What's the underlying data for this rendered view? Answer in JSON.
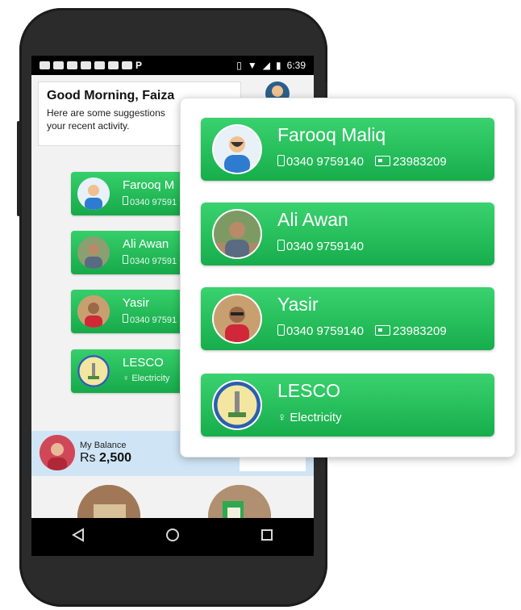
{
  "status_bar": {
    "time": "6:39",
    "battery_icon": "battery-icon"
  },
  "greeting": {
    "title": "Good Morning, Faiza",
    "subtitle_line1": "Here are some suggestions",
    "subtitle_line2": "your recent activity."
  },
  "contacts": [
    {
      "name": "Farooq Maliq",
      "phone": "0340 9759140",
      "id": "23983209",
      "avatar_icon": "user-avatar-icon"
    },
    {
      "name": "Ali Awan",
      "phone": "0340 9759140",
      "avatar_icon": "photo-avatar-icon"
    },
    {
      "name": "Yasir",
      "phone": "0340 9759140",
      "id": "23983209",
      "avatar_icon": "photo-avatar-icon"
    },
    {
      "name": "LESCO",
      "category": "Electricity",
      "avatar_icon": "lesco-logo-icon"
    }
  ],
  "small_cards": {
    "farooq_name": "Farooq M",
    "phone_trunc": "0340 97591",
    "ali_name": "Ali Awan",
    "yasir_name": "Yasir",
    "lesco_name": "LESCO",
    "lesco_cat": "Electricity"
  },
  "balance": {
    "label": "My Balance",
    "currency": "Rs",
    "amount": "2,500"
  },
  "colors": {
    "card_green": "#22bb58",
    "balance_bg": "#cfe5f5",
    "phone_body": "#2b2b2b"
  }
}
